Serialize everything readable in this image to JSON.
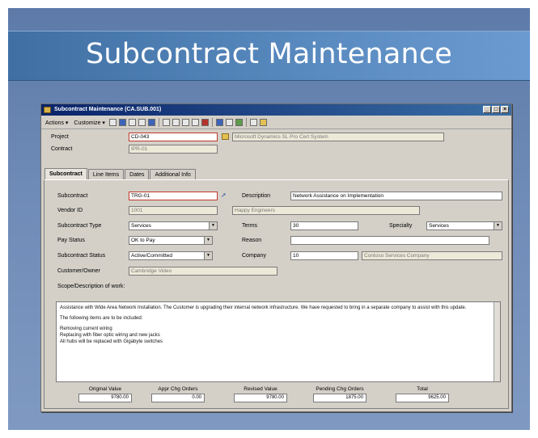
{
  "slide": {
    "title": "Subcontract Maintenance"
  },
  "window": {
    "title": "Subcontract Maintenance (CA.SUB.001)",
    "buttons": {
      "minimize": "_",
      "maximize": "□",
      "close": "×"
    }
  },
  "toolbar": {
    "menu1": "Actions ▾",
    "menu2": "Customize ▾"
  },
  "header": {
    "project_label": "Project",
    "project_value": "CD-043",
    "project_desc": "Microsoft Dynamics SL Pro Cert System",
    "contract_label": "Contract",
    "contract_value": "IPR-01"
  },
  "tabs": [
    "Subcontract",
    "Line Items",
    "Dates",
    "Additional Info"
  ],
  "form": {
    "subcontract_label": "Subcontract",
    "subcontract_value": "TRG-01",
    "description_label": "Description",
    "description_value": "Network Assistance on Implementation",
    "vendor_label": "Vendor ID",
    "vendor_value": "1001",
    "vendor_name": "Happy Engineers",
    "type_label": "Subcontract Type",
    "type_value": "Services",
    "terms_label": "Terms",
    "terms_value": "30",
    "specialty_label": "Specialty",
    "specialty_value": "Services",
    "pay_status_label": "Pay Status",
    "pay_status_value": "OK to Pay",
    "reason_label": "Reason",
    "reason_value": "",
    "status_label": "Subcontract Status",
    "status_value": "Active/Committed",
    "company_label": "Company",
    "company_value": "10",
    "company_name": "Contoso Services Company",
    "owner_label": "Customer/Owner",
    "owner_value": "Cambridge Video",
    "scope_label": "Scope/Description of work:"
  },
  "scope_text": [
    "Assistance with Wide Area Network Installation.  The Customer is upgrading their internal network infrastructure.  We have requested to bring in a separate company to assist with this update.",
    "The following items are to be included:",
    "Removing current wiring\nReplacing with fiber optic wiring and new jacks\nAll hubs will be replaced with Gigabyte switches"
  ],
  "totals": {
    "original_label": "Original Value",
    "original_value": "9780.00",
    "approved_label": "Appr Chg Orders",
    "approved_value": "0.00",
    "revised_label": "Revised Value",
    "revised_value": "9780.00",
    "pending_label": "Pending Chg Orders",
    "pending_value": "1875.00",
    "total_label": "Total",
    "total_value": "9625.00"
  }
}
